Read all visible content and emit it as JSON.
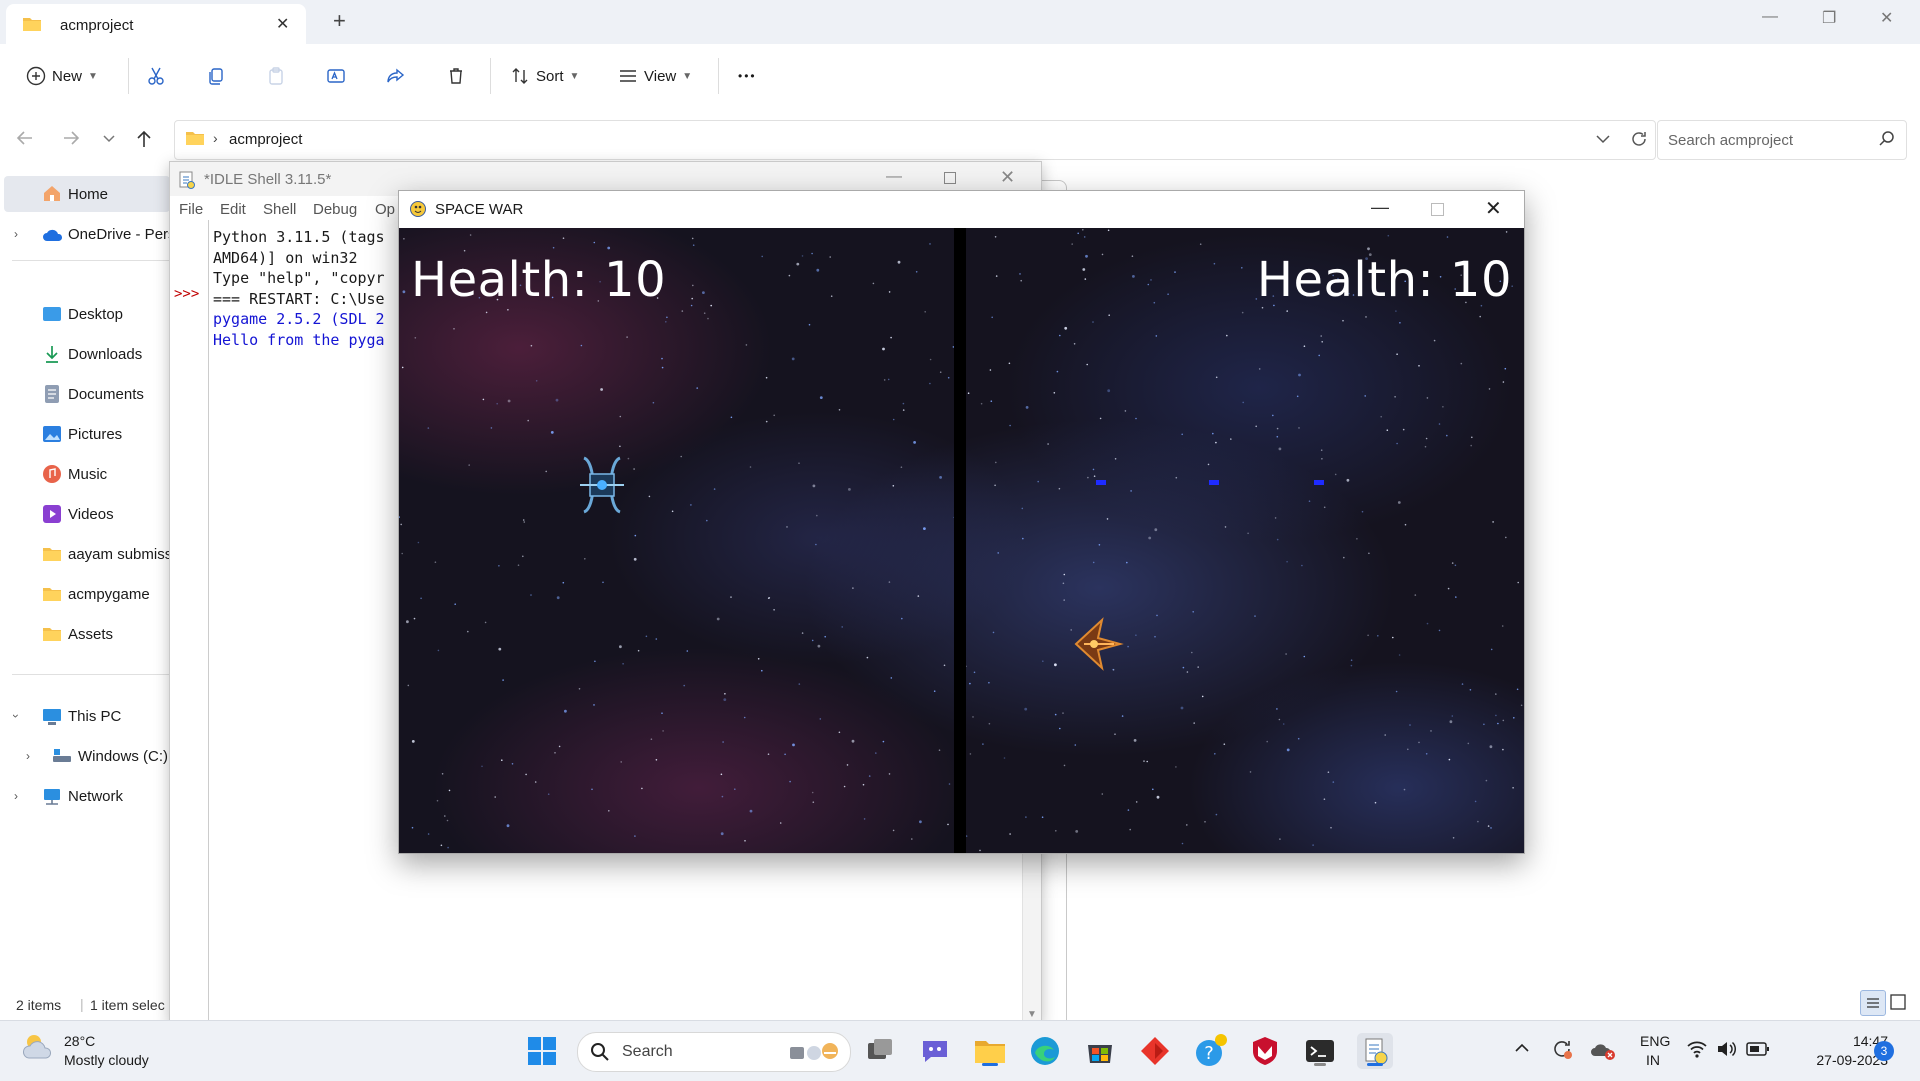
{
  "explorer": {
    "tab_title": "acmproject",
    "toolbar": {
      "new_label": "New",
      "sort_label": "Sort",
      "view_label": "View",
      "more_label": "•••"
    },
    "address": {
      "path": "acmproject",
      "search_placeholder": "Search acmproject"
    },
    "sidebar": {
      "items": [
        {
          "label": "Home"
        },
        {
          "label": "OneDrive - Pers"
        },
        {
          "label": "Desktop"
        },
        {
          "label": "Downloads"
        },
        {
          "label": "Documents"
        },
        {
          "label": "Pictures"
        },
        {
          "label": "Music"
        },
        {
          "label": "Videos"
        },
        {
          "label": "aayam submiss"
        },
        {
          "label": "acmpygame"
        },
        {
          "label": "Assets"
        },
        {
          "label": "This PC"
        },
        {
          "label": "Windows (C:)"
        },
        {
          "label": "Network"
        }
      ]
    },
    "status": {
      "items": "2 items",
      "selected": "1 item selec"
    }
  },
  "idle": {
    "title": "*IDLE Shell 3.11.5*",
    "menu": [
      "File",
      "Edit",
      "Shell",
      "Debug",
      "Op"
    ],
    "prompt": ">>>",
    "lines": [
      "Python 3.11.5 (tags",
      "AMD64)] on win32",
      "Type \"help\", \"copyr",
      "",
      "=== RESTART: C:\\Use",
      "pygame 2.5.2 (SDL 2",
      "Hello from the pyga"
    ]
  },
  "game": {
    "title": "SPACE WAR",
    "left_health": "Health: 10",
    "right_health": "Health: 10"
  },
  "taskbar": {
    "weather_temp": "28°C",
    "weather_desc": "Mostly cloudy",
    "search_label": "Search",
    "lang_line1": "ENG",
    "lang_line2": "IN",
    "time": "14:47",
    "date": "27-09-2023",
    "notification_count": "3"
  },
  "colors": {
    "accent": "#1f6fe0",
    "idle_output": "#1414d4",
    "idle_prompt": "#c00000",
    "bullet": "#1e2bff"
  }
}
